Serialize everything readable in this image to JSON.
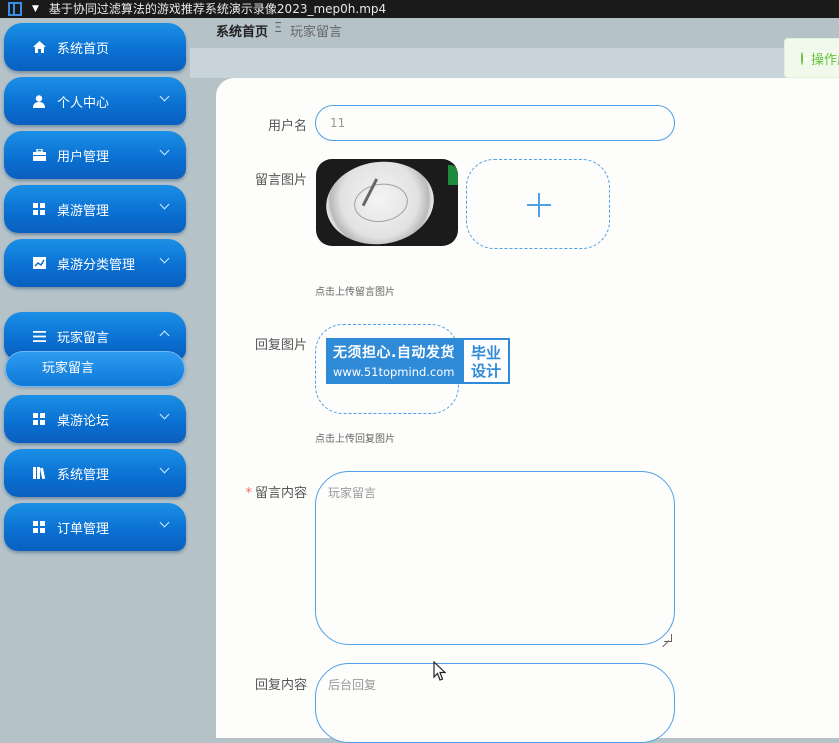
{
  "window": {
    "title": "基于协同过滤算法的游戏推荐系统演示录像2023_mep0h.mp4"
  },
  "sidebar": {
    "items": [
      {
        "label": "系统首页",
        "icon": "home-icon"
      },
      {
        "label": "个人中心",
        "icon": "user-icon"
      },
      {
        "label": "用户管理",
        "icon": "briefcase-icon"
      },
      {
        "label": "桌游管理",
        "icon": "grid-icon"
      },
      {
        "label": "桌游分类管理",
        "icon": "chart-icon"
      },
      {
        "label": "玩家留言",
        "icon": "list-icon"
      },
      {
        "label": "桌游论坛",
        "icon": "grid-icon"
      },
      {
        "label": "系统管理",
        "icon": "library-icon"
      },
      {
        "label": "订单管理",
        "icon": "grid-icon"
      }
    ],
    "active_sub_item": "玩家留言"
  },
  "breadcrumb": {
    "home": "系统首页",
    "separator": "Ξ",
    "current": "玩家留言"
  },
  "toast": {
    "text": "操作成功"
  },
  "form": {
    "username": {
      "label": "用户名",
      "value": "11"
    },
    "message_image": {
      "label": "留言图片",
      "hint": "点击上传留言图片"
    },
    "reply_image": {
      "label": "回复图片",
      "hint": "点击上传回复图片",
      "badge_line1": "无须担心.自动发货",
      "badge_line2": "www.51topmind.com",
      "badge_right": "毕业设计"
    },
    "message_content": {
      "label": "留言内容",
      "required_mark": "*",
      "placeholder": "玩家留言"
    },
    "reply_content": {
      "label": "回复内容",
      "placeholder": "后台回复"
    }
  },
  "colors": {
    "accent": "#4fa0e8",
    "sidebar_blue": "#0a6fd1",
    "success": "#67c23a",
    "required": "#f56c6c"
  }
}
